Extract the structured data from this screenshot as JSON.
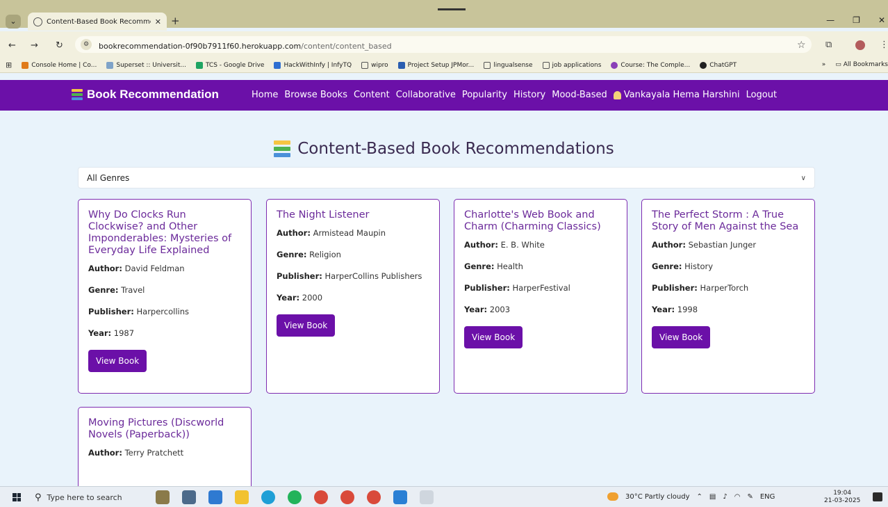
{
  "browser": {
    "tab_title": "Content-Based Book Recomme",
    "url_host": "bookrecommendation-0f90b7911f60.herokuapp.com",
    "url_path": "/content/content_based",
    "bookmarks": [
      {
        "label": "Console Home | Co...",
        "color": "#e07b1a"
      },
      {
        "label": "Superset :: Universit...",
        "color": "#7fa3c8"
      },
      {
        "label": "TCS - Google Drive",
        "color": "#1fa463"
      },
      {
        "label": "HackWithInfy | InfyTQ",
        "color": "#2f6fd1"
      },
      {
        "label": "wipro",
        "color": "#555555"
      },
      {
        "label": "Project Setup JPMor...",
        "color": "#2a5db0"
      },
      {
        "label": "lingualsense",
        "color": "#555555"
      },
      {
        "label": "job applications",
        "color": "#555555"
      },
      {
        "label": "Course: The Comple...",
        "color": "#8a3fb8"
      },
      {
        "label": "ChatGPT",
        "color": "#222222"
      }
    ],
    "more_bookmarks": "»",
    "all_bookmarks": "All Bookmarks"
  },
  "navbar": {
    "brand": "Book Recommendation",
    "links": [
      "Home",
      "Browse Books",
      "Content",
      "Collaborative",
      "Popularity",
      "History",
      "Mood-Based"
    ],
    "user": "Vankayala Hema Harshini",
    "logout": "Logout",
    "bg_color": "#6b10a8"
  },
  "main": {
    "heading": "Content-Based Book Recommendations",
    "genre_filter": "All Genres",
    "labels": {
      "author": "Author:",
      "genre": "Genre:",
      "publisher": "Publisher:",
      "year": "Year:"
    },
    "button_label": "View Book",
    "books": [
      {
        "title": "Why Do Clocks Run Clockwise? and Other Imponderables: Mysteries of Everyday Life Explained",
        "author": "David Feldman",
        "genre": "Travel",
        "publisher": "Harpercollins",
        "year": "1987"
      },
      {
        "title": "The Night Listener",
        "author": "Armistead Maupin",
        "genre": "Religion",
        "publisher": "HarperCollins Publishers",
        "year": "2000"
      },
      {
        "title": "Charlotte's Web Book and Charm (Charming Classics)",
        "author": "E. B. White",
        "genre": "Health",
        "publisher": "HarperFestival",
        "year": "2003"
      },
      {
        "title": "The Perfect Storm : A True Story of Men Against the Sea",
        "author": "Sebastian Junger",
        "genre": "History",
        "publisher": "HarperTorch",
        "year": "1998"
      },
      {
        "title": "Moving Pictures (Discworld Novels (Paperback))",
        "author": "Terry Pratchett"
      }
    ]
  },
  "taskbar": {
    "search_placeholder": "Type here to search",
    "weather": "30°C  Partly cloudy",
    "lang": "ENG",
    "time": "19:04",
    "date": "21-03-2025"
  }
}
